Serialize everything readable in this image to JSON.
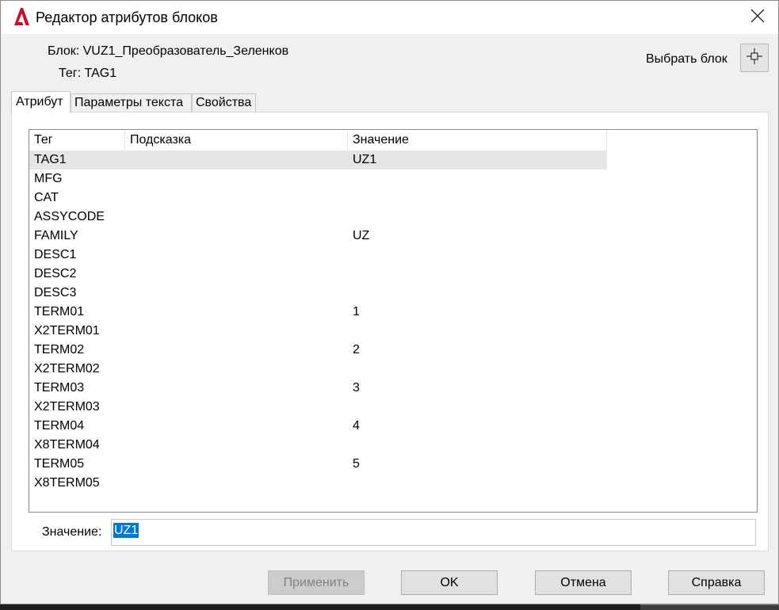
{
  "window": {
    "title": "Редактор атрибутов блоков",
    "icon": "autocad-a-icon",
    "close_icon": "close-icon"
  },
  "block": {
    "block_label": "Блок: VUZ1_Преобразователь_Зеленков",
    "tag_label": "Тег: TAG1",
    "pick_label": "Выбрать блок",
    "pick_icon": "crosshair-icon"
  },
  "tabs": [
    {
      "label": "Атрибут",
      "active": true
    },
    {
      "label": "Параметры текста",
      "active": false
    },
    {
      "label": "Свойства",
      "active": false
    }
  ],
  "table": {
    "columns": [
      "Тег",
      "Подсказка",
      "Значение"
    ],
    "rows": [
      {
        "tag": "TAG1",
        "prompt": "",
        "value": "UZ1",
        "selected": true
      },
      {
        "tag": "MFG",
        "prompt": "",
        "value": ""
      },
      {
        "tag": "CAT",
        "prompt": "",
        "value": ""
      },
      {
        "tag": "ASSYCODE",
        "prompt": "",
        "value": ""
      },
      {
        "tag": "FAMILY",
        "prompt": "",
        "value": "UZ"
      },
      {
        "tag": "DESC1",
        "prompt": "",
        "value": ""
      },
      {
        "tag": "DESC2",
        "prompt": "",
        "value": ""
      },
      {
        "tag": "DESC3",
        "prompt": "",
        "value": ""
      },
      {
        "tag": "TERM01",
        "prompt": "",
        "value": "1"
      },
      {
        "tag": "X2TERM01",
        "prompt": "",
        "value": ""
      },
      {
        "tag": "TERM02",
        "prompt": "",
        "value": "2"
      },
      {
        "tag": "X2TERM02",
        "prompt": "",
        "value": ""
      },
      {
        "tag": "TERM03",
        "prompt": "",
        "value": "3"
      },
      {
        "tag": "X2TERM03",
        "prompt": "",
        "value": ""
      },
      {
        "tag": "TERM04",
        "prompt": "",
        "value": "4"
      },
      {
        "tag": "X8TERM04",
        "prompt": "",
        "value": ""
      },
      {
        "tag": "TERM05",
        "prompt": "",
        "value": "5"
      },
      {
        "tag": "X8TERM05",
        "prompt": "",
        "value": ""
      }
    ]
  },
  "value_field": {
    "label": "Значение:",
    "value": "UZ1"
  },
  "buttons": {
    "apply": "Применить",
    "ok": "OK",
    "cancel": "Отмена",
    "help": "Справка"
  },
  "colors": {
    "selection": "#0078d7",
    "row_selected": "#e5e5e5",
    "brand": "#c8102e"
  }
}
